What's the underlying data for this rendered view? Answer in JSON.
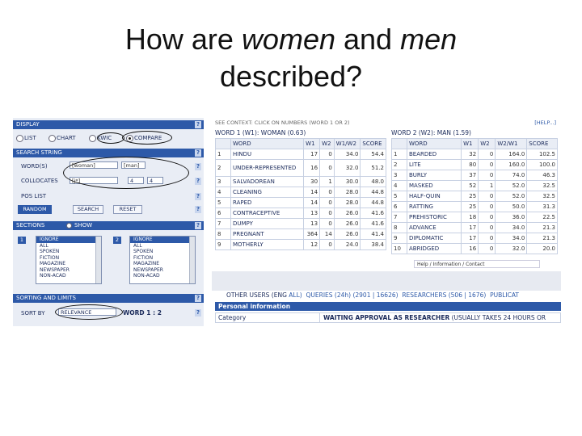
{
  "slide": {
    "title_pre": "How are ",
    "title_women": "women",
    "title_mid": " and ",
    "title_men": "men",
    "title_post": " described?"
  },
  "left": {
    "display_header": "DISPLAY",
    "display_options": [
      "LIST",
      "CHART",
      "KWIC",
      "COMPARE"
    ],
    "selected_display": "COMPARE",
    "search_header": "SEARCH STRING",
    "words_label": "WORD(S)",
    "word1": "[woman]",
    "word2": "[man]",
    "collocates_label": "COLLOCATES",
    "collocates_value": "[j*]",
    "span_left": "4",
    "span_right": "4",
    "pos_label": "POS LIST",
    "random_button": "RANDOM",
    "search_button": "SEARCH",
    "reset_button": "RESET",
    "sections_header": "SECTIONS",
    "show_label": "SHOW",
    "section_tag_1": "1",
    "section_tag_2": "2",
    "list1": [
      "IGNORE",
      "ALL",
      "SPOKEN",
      "FICTION",
      "MAGAZINE",
      "NEWSPAPER",
      "NON-ACAD"
    ],
    "list2": [
      "IGNORE",
      "ALL",
      "SPOKEN",
      "FICTION",
      "MAGAZINE",
      "NEWSPAPER",
      "NON-ACAD"
    ],
    "sorting_header": "SORTING AND LIMITS",
    "sort_label": "SORT BY",
    "sort_value": "RELEVANCE",
    "sort_ratio": "WORD 1 : 2",
    "help_glyph": "?"
  },
  "right": {
    "context_line": "SEE CONTEXT: CLICK ON NUMBERS (WORD 1 OR 2)",
    "help_link": "[HELP...]",
    "word1_header": "WORD 1 (W1): WOMAN (0.63)",
    "word2_header": "WORD 2 (W2): MAN (1.59)",
    "columns": [
      "WORD",
      "W1",
      "W2",
      "W1/W2",
      "SCORE"
    ],
    "columns2": [
      "WORD",
      "W1",
      "W2",
      "W2/W1",
      "SCORE"
    ],
    "table1": [
      {
        "rank": "1",
        "word": "HINDU",
        "w1": "17",
        "w2": "0",
        "ratio": "34.0",
        "score": "54.4"
      },
      {
        "rank": "2",
        "word": "UNDER-REPRESENTED",
        "w1": "16",
        "w2": "0",
        "ratio": "32.0",
        "score": "51.2"
      },
      {
        "rank": "3",
        "word": "SALVADOREAN",
        "w1": "30",
        "w2": "1",
        "ratio": "30.0",
        "score": "48.0"
      },
      {
        "rank": "4",
        "word": "CLEANING",
        "w1": "14",
        "w2": "0",
        "ratio": "28.0",
        "score": "44.8"
      },
      {
        "rank": "5",
        "word": "RAPED",
        "w1": "14",
        "w2": "0",
        "ratio": "28.0",
        "score": "44.8"
      },
      {
        "rank": "6",
        "word": "CONTRACEPTIVE",
        "w1": "13",
        "w2": "0",
        "ratio": "26.0",
        "score": "41.6"
      },
      {
        "rank": "7",
        "word": "DUMPY",
        "w1": "13",
        "w2": "0",
        "ratio": "26.0",
        "score": "41.6"
      },
      {
        "rank": "8",
        "word": "PREGNANT",
        "w1": "364",
        "w2": "14",
        "ratio": "26.0",
        "score": "41.4"
      },
      {
        "rank": "9",
        "word": "MOTHERLY",
        "w1": "12",
        "w2": "0",
        "ratio": "24.0",
        "score": "38.4"
      }
    ],
    "table2": [
      {
        "rank": "1",
        "word": "BEARDED",
        "w1": "32",
        "w2": "0",
        "ratio": "164.0",
        "score": "102.5"
      },
      {
        "rank": "2",
        "word": "LITE",
        "w1": "80",
        "w2": "0",
        "ratio": "160.0",
        "score": "100.0"
      },
      {
        "rank": "3",
        "word": "BURLY",
        "w1": "37",
        "w2": "0",
        "ratio": "74.0",
        "score": "46.3"
      },
      {
        "rank": "4",
        "word": "MASKED",
        "w1": "52",
        "w2": "1",
        "ratio": "52.0",
        "score": "32.5"
      },
      {
        "rank": "5",
        "word": "HALF-QUIN",
        "w1": "25",
        "w2": "0",
        "ratio": "52.0",
        "score": "32.5"
      },
      {
        "rank": "6",
        "word": "RATTING",
        "w1": "25",
        "w2": "0",
        "ratio": "50.0",
        "score": "31.3"
      },
      {
        "rank": "7",
        "word": "PREHISTORIC",
        "w1": "18",
        "w2": "0",
        "ratio": "36.0",
        "score": "22.5"
      },
      {
        "rank": "8",
        "word": "ADVANCE",
        "w1": "17",
        "w2": "0",
        "ratio": "34.0",
        "score": "21.3"
      },
      {
        "rank": "9",
        "word": "DIPLOMATIC",
        "w1": "17",
        "w2": "0",
        "ratio": "34.0",
        "score": "21.3"
      },
      {
        "rank": "10",
        "word": "ABRIDGED",
        "w1": "16",
        "w2": "0",
        "ratio": "32.0",
        "score": "20.0"
      }
    ],
    "help_note": "Help / Information / Contact",
    "others_prefix": "OTHER USERS (ENG",
    "others_all": "ALL)",
    "others_queries": "QUERIES (24h) (2901 | 16626)",
    "others_researchers": "RESEARCHERS (506 | 1676)",
    "others_public": "PUBLICAT",
    "personal_header": "Personal information",
    "category_label": "Category",
    "category_value": "WAITING APPROVAL AS RESEARCHER",
    "category_note": "(USUALLY TAKES 24 HOURS OR"
  }
}
